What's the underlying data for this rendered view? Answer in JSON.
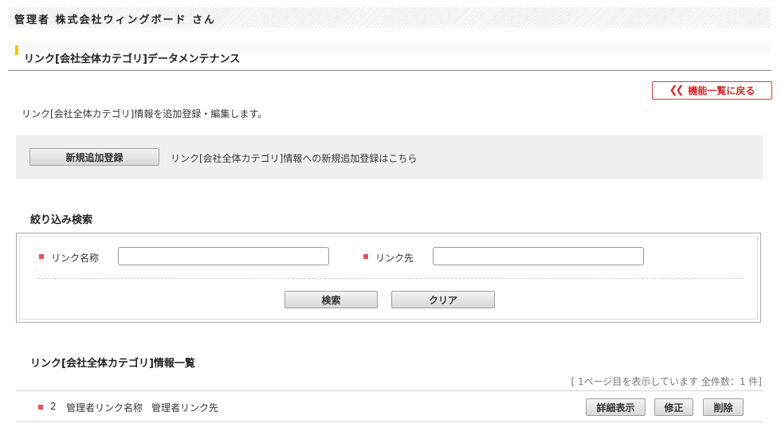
{
  "header": {
    "user_text": "管理者 株式会社ウィングボード さん"
  },
  "page": {
    "title": "リンク[会社全体カテゴリ]データメンテナンス"
  },
  "back_button": {
    "icon": "double-chevron-left-icon",
    "label": "機能一覧に戻る"
  },
  "intro": "リンク[会社全体カテゴリ]情報を追加登録・編集します。",
  "add_section": {
    "button_label": "新規追加登録",
    "description": "リンク[会社全体カテゴリ]情報への新規追加登録はこちら"
  },
  "search": {
    "heading": "絞り込み検索",
    "fields": [
      {
        "label": "リンク名称",
        "value": ""
      },
      {
        "label": "リンク先",
        "value": ""
      }
    ],
    "search_label": "検索",
    "clear_label": "クリア"
  },
  "list": {
    "heading": "リンク[会社全体カテゴリ]情報一覧",
    "page_info": "[ 1ページ目を表示しています 全件数：1 件]",
    "rows": [
      {
        "id": "2",
        "name": "管理者リンク名称",
        "target": "管理者リンク先"
      }
    ],
    "actions": {
      "detail": "詳細表示",
      "edit": "修正",
      "delete": "削除"
    }
  },
  "colors": {
    "accent_yellow": "#f5c200",
    "back_red": "#d9262b",
    "bullet_red": "#e6505b"
  }
}
